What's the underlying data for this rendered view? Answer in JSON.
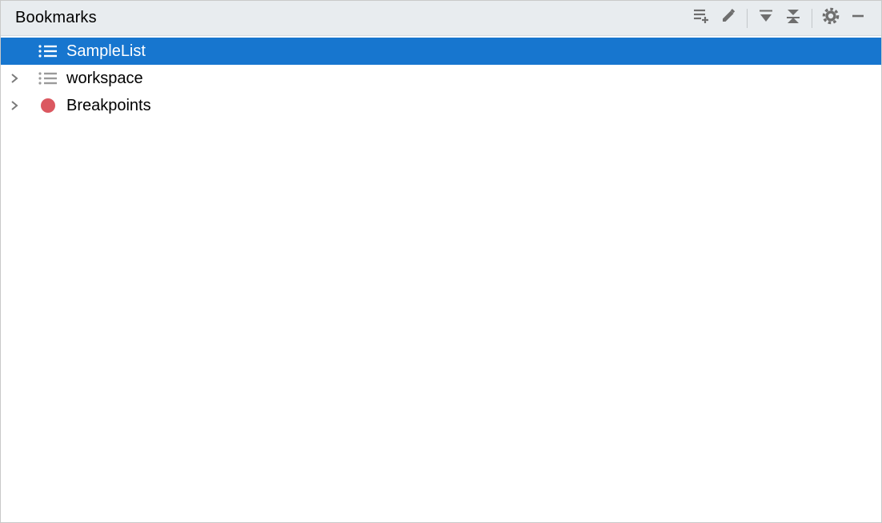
{
  "panel": {
    "title": "Bookmarks"
  },
  "toolbar": {
    "add": {
      "name": "add-list-icon"
    },
    "edit": {
      "name": "pencil-icon"
    },
    "expand_all": {
      "name": "expand-all-icon"
    },
    "collapse_all": {
      "name": "collapse-all-icon"
    },
    "settings": {
      "name": "gear-icon"
    },
    "minimize": {
      "name": "minimize-icon"
    }
  },
  "tree": {
    "items": [
      {
        "label": "SampleList",
        "icon": "list",
        "expandable": false,
        "selected": true
      },
      {
        "label": "workspace",
        "icon": "list",
        "expandable": true,
        "selected": false
      },
      {
        "label": "Breakpoints",
        "icon": "breakpoint",
        "expandable": true,
        "selected": false
      }
    ]
  },
  "colors": {
    "selection": "#1776cf",
    "breakpoint": "#db5860",
    "icon_gray": "#6e6e6e",
    "header_bg": "#e8ecef"
  }
}
